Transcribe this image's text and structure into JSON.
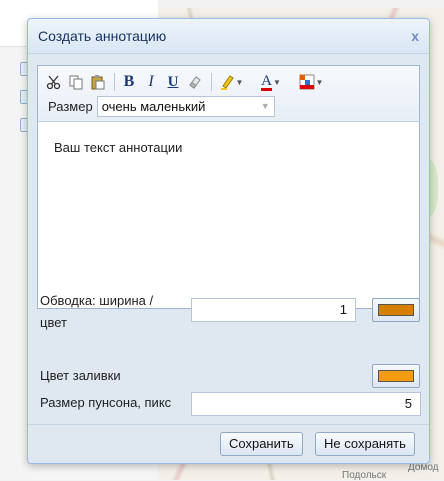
{
  "dialog": {
    "title": "Создать аннотацию",
    "close_glyph": "x"
  },
  "toolbar": {
    "icons": [
      "scissors-icon",
      "copy-icon",
      "paste-icon",
      "bold-icon",
      "italic-icon",
      "underline-icon",
      "eraser-icon",
      "highlighter-icon",
      "font-color-icon",
      "background-color-icon"
    ],
    "bold_glyph": "B",
    "italic_glyph": "I",
    "underline_glyph": "U",
    "font_color_glyph": "A",
    "size_label": "Размер",
    "size_value": "очень маленький"
  },
  "editor": {
    "text": "Ваш текст аннотации"
  },
  "form": {
    "stroke_label_line1": "Обводка: ширина /",
    "stroke_label_line2": "цвет",
    "stroke_width": "1",
    "stroke_color": "#d68000",
    "fill_label": "Цвет заливки",
    "fill_color": "#f39c12",
    "punch_label": "Размер пунсона, пикс",
    "punch_size": "5"
  },
  "footer": {
    "save_label": "Сохранить",
    "dont_save_label": "Не сохранять"
  },
  "background": {
    "map_labels": [
      "Домод",
      "Подольск"
    ]
  }
}
